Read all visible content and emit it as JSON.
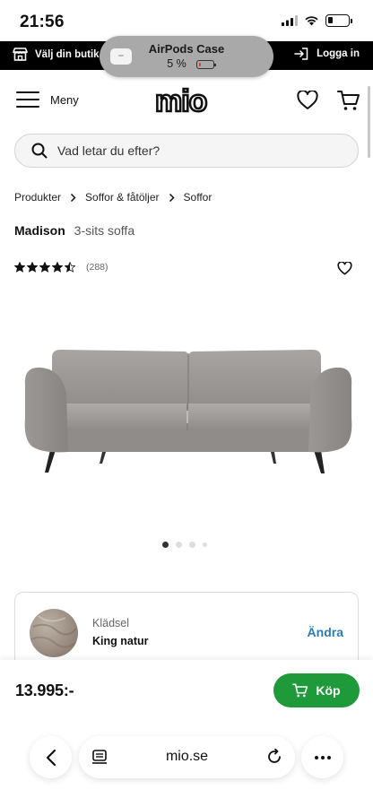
{
  "status_bar": {
    "time": "21:56"
  },
  "store_bar": {
    "store_label": "Välj din butik",
    "login_label": "Logga in"
  },
  "airpods": {
    "title": "AirPods Case",
    "battery_text": "5 %"
  },
  "header": {
    "menu_label": "Meny",
    "logo_text": "mio"
  },
  "search": {
    "placeholder": "Vad letar du efter?"
  },
  "breadcrumb": [
    "Produkter",
    "Soffor & fåtöljer",
    "Soffor"
  ],
  "product": {
    "name": "Madison",
    "subtitle": "3-sits soffa",
    "rating": 4.5,
    "rating_count": "(288)",
    "gallery_total": 4,
    "gallery_active": 1
  },
  "fabric": {
    "label": "Klädsel",
    "value": "King natur",
    "change_label": "Ändra"
  },
  "buy": {
    "price": "13.995:-",
    "button_label": "Köp",
    "color": "#1f9a3a"
  },
  "browser": {
    "url": "mio.se"
  }
}
